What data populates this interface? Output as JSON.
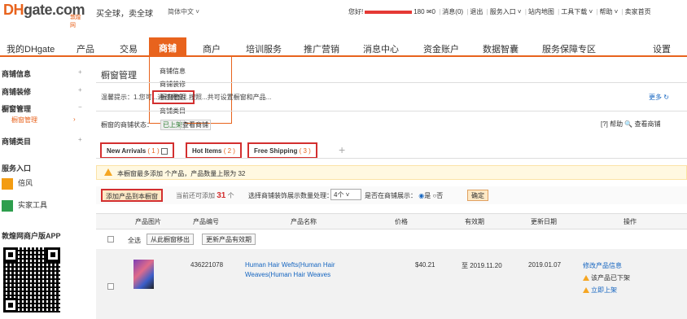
{
  "header": {
    "logo_main": "DH",
    "logo_gate": "gate.com",
    "logo_sub": "敦煌网",
    "slogan": "买全球，卖全球",
    "lang": "简体中文 ˅",
    "user_prefix": "您好!",
    "user_count": "180",
    "msg_count": "0",
    "links": [
      "消息",
      "(0)",
      "退出",
      "服务入口 ˅",
      "站内地图",
      "工具下载 ˅",
      "帮助 ˅",
      "卖家首页"
    ]
  },
  "nav": {
    "items": [
      "我的DHgate",
      "产品",
      "交易",
      "商铺",
      "商户",
      "培训服务",
      "推广营销",
      "消息中心",
      "资金账户",
      "数据智囊",
      "服务保障专区",
      "设置"
    ],
    "active_index": 3
  },
  "dropdown": {
    "items": [
      "商铺信息",
      "商铺装修",
      "橱窗管理",
      "商铺类目"
    ],
    "selected_index": 2
  },
  "sidebar": {
    "items": [
      {
        "label": "商铺信息",
        "expander": "+"
      },
      {
        "label": "商铺装修",
        "expander": "+"
      },
      {
        "label": "橱窗管理",
        "expander": "−"
      },
      {
        "label": "商铺类目",
        "expander": "+"
      }
    ],
    "sub_item": "橱窗管理",
    "service_title": "服务入口",
    "services": [
      "倍风",
      "实家工具"
    ],
    "app_title": "敦煌网商户版APP"
  },
  "main": {
    "title": "橱窗管理",
    "tip": "温馨提示：1.您可...通过橱窗...按照...共可设置橱窗和产品...",
    "tip_right": "更多 ↻",
    "status_label": "橱窗的商铺状态：",
    "status_tag": "已上架",
    "status_link": "查看商铺",
    "help_links": "[?] 帮助   🔍 查看商铺",
    "tabs": [
      {
        "label": "New Arrivals",
        "count": "( 1 )"
      },
      {
        "label": "Hot Items",
        "count": "( 2 )"
      },
      {
        "label": "Free Shipping",
        "count": "( 3 )"
      }
    ],
    "tab_add": "+",
    "warning": "本橱窗最多添加 个产品，产品数量上限为 32",
    "add_button": "添加产品到本橱窗",
    "added_prefix": "当前还可添加",
    "added_count": "31",
    "added_suffix": "个",
    "sort_label": "选择商铺装饰展示数量处理：",
    "sort_value": "4个 ˅",
    "show_label": "是否在商铺展示：",
    "show_yes": "是",
    "show_no": "否",
    "confirm_button": "确定",
    "table": {
      "headers": [
        "产品图片",
        "产品编号",
        "产品名称",
        "价格",
        "有效期",
        "更新日期",
        "操作"
      ],
      "select_all": "全选",
      "btn_remove": "从此橱窗移出",
      "btn_update": "更新产品有效期",
      "rows": [
        {
          "id": "436221078",
          "name_line1": "Human Hair Wefts(Human Hair",
          "name_line2": "Weaves(Human Hair Weaves",
          "price": "$40.21",
          "valid": "至 2019.11.20",
          "updated": "2019.01.07",
          "ops": [
            "修改产品信息",
            "该产品已下架",
            "立即上架"
          ]
        }
      ]
    }
  }
}
